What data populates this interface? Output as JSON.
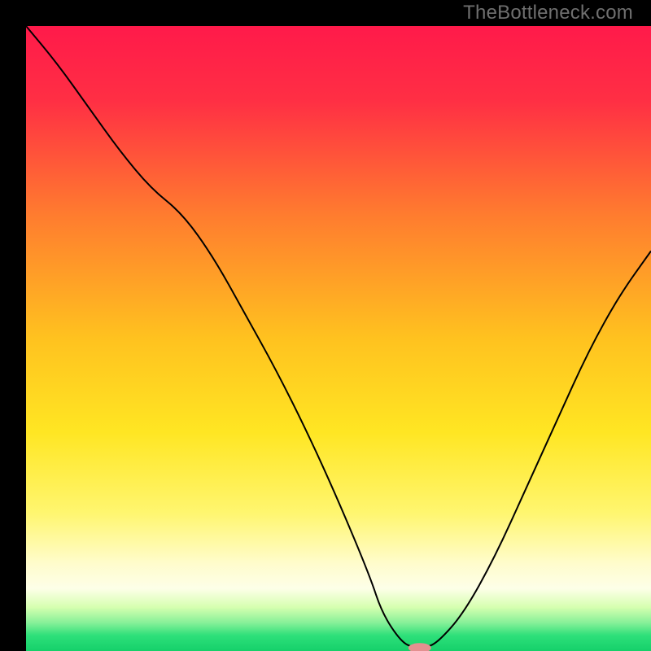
{
  "watermark": "TheBottleneck.com",
  "chart_data": {
    "type": "line",
    "title": "",
    "xlabel": "",
    "ylabel": "",
    "xlim": [
      0,
      100
    ],
    "ylim": [
      0,
      100
    ],
    "grid": false,
    "legend": false,
    "background_gradient_stops": [
      {
        "offset": 0.0,
        "color": "#ff1a4a"
      },
      {
        "offset": 0.12,
        "color": "#ff2f44"
      },
      {
        "offset": 0.3,
        "color": "#ff7b2f"
      },
      {
        "offset": 0.5,
        "color": "#ffc21f"
      },
      {
        "offset": 0.65,
        "color": "#ffe623"
      },
      {
        "offset": 0.78,
        "color": "#fff670"
      },
      {
        "offset": 0.86,
        "color": "#fffccc"
      },
      {
        "offset": 0.9,
        "color": "#fdffe8"
      },
      {
        "offset": 0.93,
        "color": "#d6ffb0"
      },
      {
        "offset": 0.955,
        "color": "#86f098"
      },
      {
        "offset": 0.975,
        "color": "#2ee07a"
      },
      {
        "offset": 1.0,
        "color": "#15d06a"
      }
    ],
    "series": [
      {
        "name": "bottleneck-curve",
        "stroke": "#000000",
        "stroke_width": 2,
        "x": [
          0,
          5,
          10,
          15,
          20,
          25,
          30,
          35,
          40,
          45,
          50,
          55,
          57,
          60,
          62,
          64,
          66,
          70,
          75,
          80,
          85,
          90,
          95,
          100
        ],
        "y": [
          100,
          94,
          87,
          80,
          74,
          70,
          63,
          54,
          45,
          35,
          24,
          12,
          6,
          1.5,
          0.5,
          0.5,
          1.5,
          6,
          15,
          26,
          37,
          48,
          57,
          64
        ]
      }
    ],
    "marker": {
      "name": "optimal-marker",
      "x": 63,
      "y": 0.5,
      "color": "#e49090",
      "rx": 14,
      "ry": 6
    }
  }
}
